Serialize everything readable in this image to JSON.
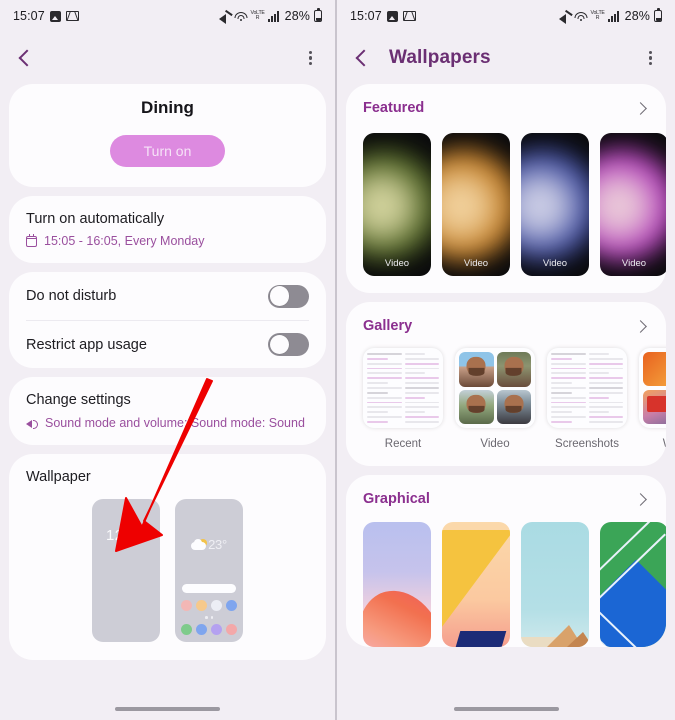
{
  "status_bar": {
    "time": "15:07",
    "battery_percent": "28%",
    "icons": [
      "photo-icon",
      "gmail-icon",
      "mute-icon",
      "wifi-icon",
      "volte-icon",
      "signal-bars-icon",
      "battery-icon"
    ],
    "volte_line1": "VoLTE",
    "volte_line2": "R"
  },
  "left_screen": {
    "appbar": {
      "back": "back-chevron-icon",
      "menu": "kebab-menu-icon"
    },
    "dining": {
      "title": "Dining",
      "turn_on_label": "Turn on"
    },
    "auto": {
      "title": "Turn on automatically",
      "schedule": "15:05 - 16:05, Every Monday"
    },
    "toggles": [
      {
        "label": "Do not disturb",
        "state": "off"
      },
      {
        "label": "Restrict app usage",
        "state": "off"
      }
    ],
    "change_settings": {
      "title": "Change settings",
      "detail": "Sound mode and volume: Sound mode: Sound"
    },
    "wallpaper": {
      "title": "Wallpaper",
      "lock_preview_time": "12:45",
      "home_preview_temp": "23°"
    }
  },
  "right_screen": {
    "appbar": {
      "title": "Wallpapers",
      "back": "back-chevron-icon",
      "menu": "kebab-menu-icon"
    },
    "sections": [
      {
        "title": "Featured",
        "items": [
          {
            "label": "Video",
            "color_outer": "#4a5e20",
            "color_inner": "#cfd09a"
          },
          {
            "label": "Video",
            "color_outer": "#c07a23",
            "color_inner": "#f0cf9a"
          },
          {
            "label": "Video",
            "color_outer": "#3d4a9e",
            "color_inner": "#c9cbe4"
          },
          {
            "label": "Video",
            "color_outer": "#b03bb8",
            "color_inner": "#e9c6d8"
          }
        ]
      },
      {
        "title": "Gallery",
        "items": [
          {
            "label": "Recent"
          },
          {
            "label": "Video"
          },
          {
            "label": "Screenshots"
          },
          {
            "label": "Whats"
          }
        ]
      },
      {
        "title": "Graphical",
        "items": [
          {
            "label": ""
          },
          {
            "label": ""
          },
          {
            "label": ""
          },
          {
            "label": ""
          }
        ]
      }
    ]
  },
  "annotation": {
    "type": "arrow",
    "color": "#ee0000",
    "points_to": "wallpaper-preview"
  },
  "colors": {
    "background": "#f2eef4",
    "card": "#fdfcfe",
    "accent_purple": "#8b2f8f",
    "accent_link": "#9a4f9e",
    "button_pink": "#dd8ae0",
    "annotation_red": "#ee0000"
  }
}
